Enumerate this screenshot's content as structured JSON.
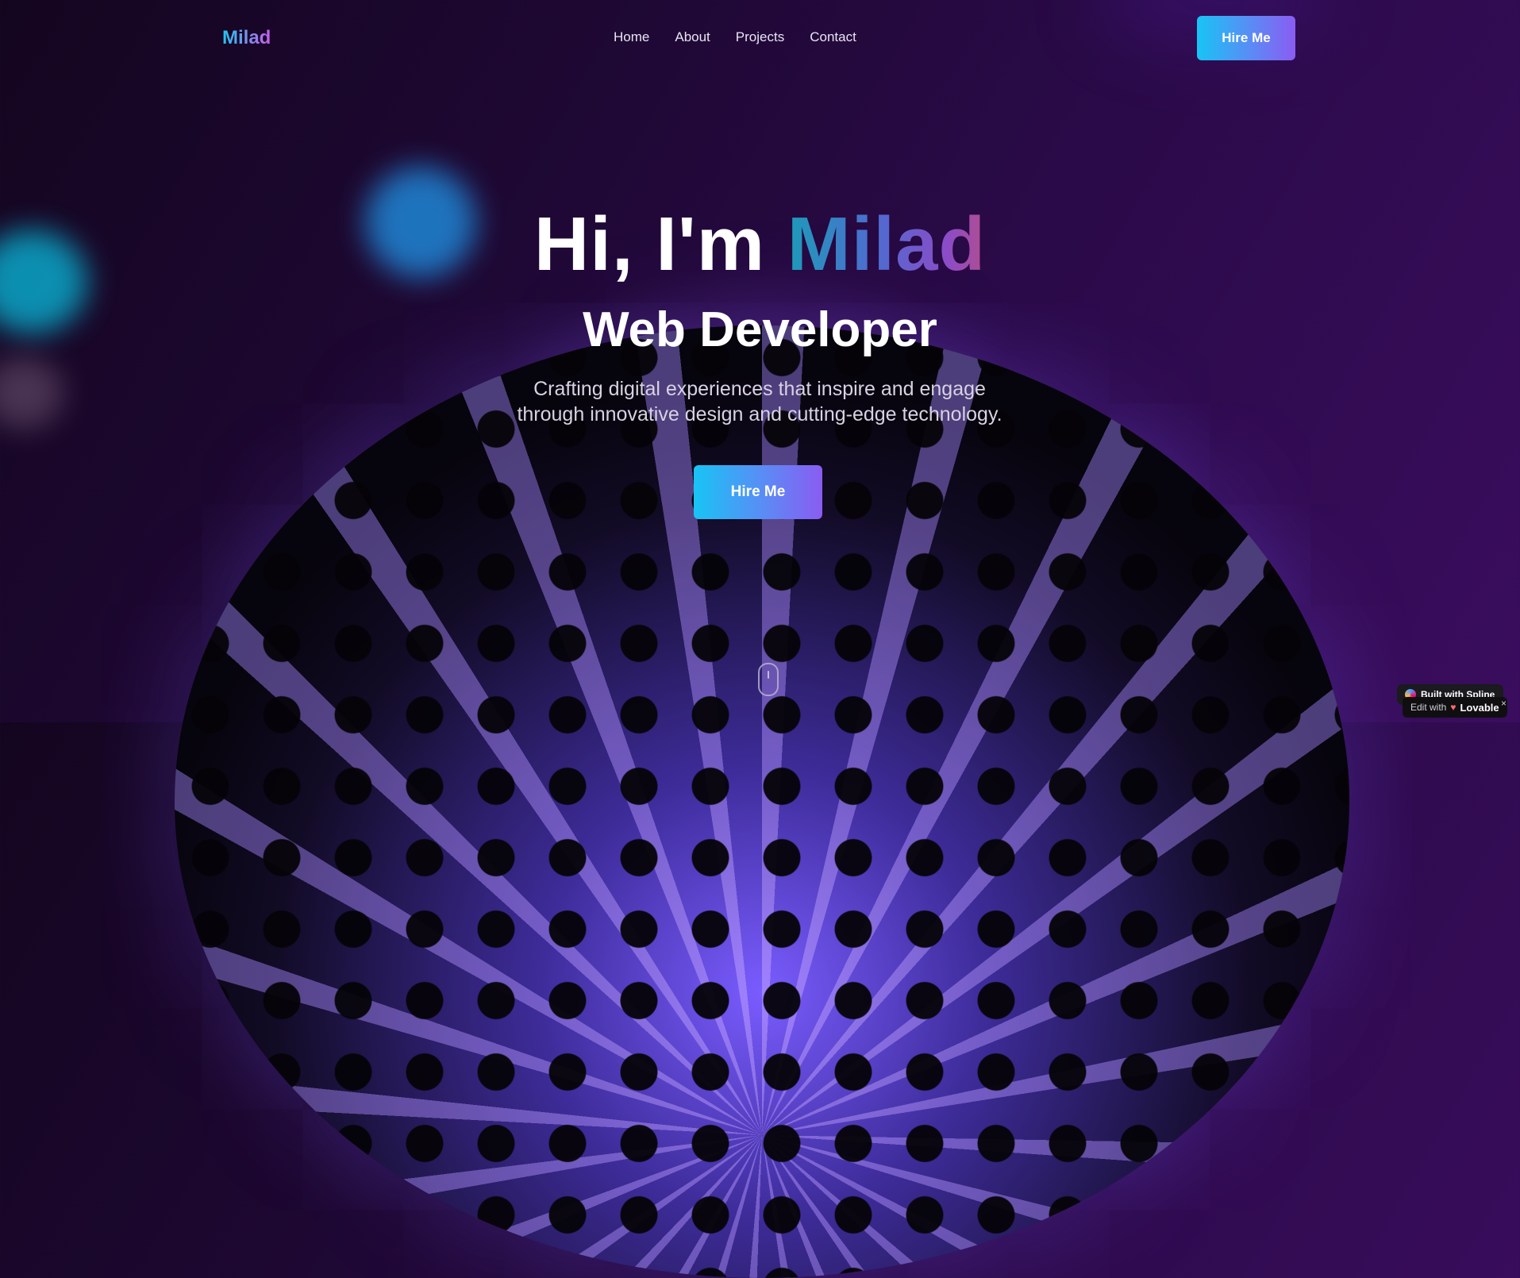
{
  "nav": {
    "logo": "Milad",
    "links": [
      "Home",
      "About",
      "Projects",
      "Contact"
    ],
    "cta": "Hire Me"
  },
  "hero": {
    "greeting": "Hi, I'm",
    "name": "Milad",
    "role": "Web Developer",
    "description_line1": "Crafting digital experiences that inspire and engage",
    "description_line2": "through innovative design and cutting-edge technology.",
    "cta": "Hire Me"
  },
  "badges": {
    "spline": "Built with Spline",
    "lovable_prefix": "Edit with",
    "lovable_brand": "Lovable",
    "close": "×"
  },
  "icons": {
    "scroll": "mouse-scroll-icon",
    "spline": "spline-logo-icon",
    "lovable": "heart-icon"
  },
  "colors": {
    "accent_start": "#18c4f5",
    "accent_end": "#8a5cf2",
    "background": "#1f0835"
  }
}
